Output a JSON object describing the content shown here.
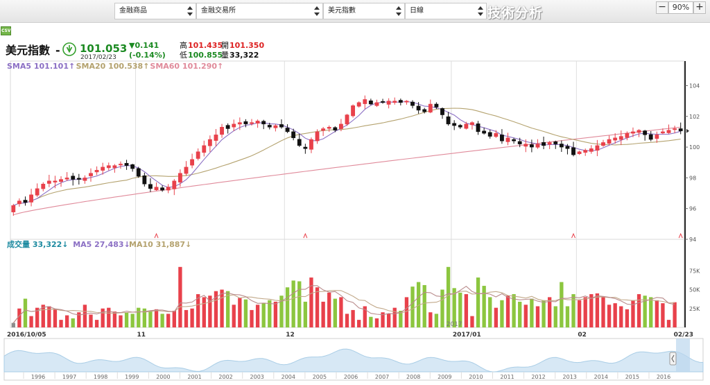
{
  "toolbar": {
    "selects": [
      {
        "value": "金融商品"
      },
      {
        "value": "金融交易所"
      },
      {
        "value": "美元指數"
      },
      {
        "value": "日線"
      }
    ],
    "title": "技術分析",
    "zoom": {
      "minus": "−",
      "level": "90%",
      "plus": "+"
    },
    "csv_label": "CSV"
  },
  "colors": {
    "up": "#e8414b",
    "down": "#111111",
    "vol_up": "#e8414b",
    "vol_down": "#8cc63f",
    "vol_neutral": "#8c8c8c",
    "sma5": "#8b6fc4",
    "sma20": "#b4a26e",
    "sma60": "#e08a9a",
    "ma5_vol": "#b88a8a",
    "ma10_vol": "#c2a98a",
    "navigator": "#a9cde6"
  },
  "chart_data": {
    "type": "candlestick",
    "symbol": "美元指數",
    "quote": {
      "last": "101.053",
      "date": "2017/02/23",
      "change": "▼0.141",
      "change_pct": "(-0.14%)",
      "high_label": "高",
      "high": "101.435",
      "open_label": "開",
      "open": "101.350",
      "low_label": "低",
      "low": "100.855",
      "volume_label": "量",
      "volume": "33,322"
    },
    "sma_legend": [
      {
        "label": "SMA5",
        "value": "101.101",
        "arrow": "↑"
      },
      {
        "label": "SMA20",
        "value": "100.538",
        "arrow": "↑"
      },
      {
        "label": "SMA60",
        "value": "101.290",
        "arrow": "↑"
      }
    ],
    "volume_legend": [
      {
        "label": "成交量",
        "value": "33,322",
        "arrow": "↓"
      },
      {
        "label": "MA5",
        "value": "27,483",
        "arrow": "↓"
      },
      {
        "label": "MA10",
        "value": "31,887",
        "arrow": "↓"
      }
    ],
    "price_axis": {
      "ylim": [
        94,
        105.6
      ],
      "ticks": [
        "104",
        "102",
        "100",
        "98",
        "96",
        "94"
      ]
    },
    "volume_axis": {
      "ylim": [
        0,
        100000
      ],
      "ticks": [
        "75K",
        "50K",
        "25K"
      ]
    },
    "x_labels": [
      "2016/10/05",
      "11",
      "12",
      "2017/01",
      "02",
      "02/23"
    ],
    "x_label_index": [
      0,
      21,
      46,
      74,
      95,
      112
    ],
    "year_watermark": "2017",
    "navigator_years": [
      "1996",
      "1997",
      "1998",
      "1999",
      "2000",
      "2001",
      "2002",
      "2003",
      "2004",
      "2005",
      "2006",
      "2007",
      "2008",
      "2009",
      "2010",
      "2011",
      "2012",
      "2013",
      "2014",
      "2015",
      "2016"
    ],
    "close": [
      96.2,
      96.5,
      96.4,
      96.9,
      97.3,
      97.6,
      97.8,
      97.8,
      97.9,
      98.0,
      97.9,
      97.9,
      98.0,
      98.3,
      98.5,
      98.7,
      98.8,
      98.8,
      98.9,
      98.8,
      98.6,
      98.1,
      97.6,
      97.3,
      97.4,
      97.2,
      97.4,
      97.8,
      98.3,
      98.7,
      99.2,
      99.7,
      100.1,
      100.5,
      100.8,
      101.3,
      101.2,
      101.5,
      101.6,
      101.5,
      101.6,
      101.7,
      101.5,
      101.3,
      101.4,
      101.3,
      101.0,
      100.6,
      100.1,
      99.9,
      100.5,
      101.0,
      101.2,
      101.3,
      101.1,
      101.5,
      102.1,
      102.7,
      102.9,
      103.1,
      102.8,
      102.9,
      102.9,
      103.0,
      103.0,
      102.9,
      103.0,
      102.7,
      102.4,
      102.3,
      102.8,
      102.6,
      102.1,
      101.5,
      101.4,
      101.3,
      101.5,
      101.6,
      101.0,
      100.9,
      100.7,
      100.9,
      100.4,
      100.6,
      100.4,
      100.2,
      100.2,
      100.0,
      100.2,
      100.1,
      100.3,
      100.2,
      100.0,
      99.9,
      99.5,
      99.7,
      99.8,
      99.9,
      100.1,
      100.3,
      100.5,
      100.6,
      100.7,
      100.9,
      101.0,
      101.1,
      100.8,
      100.5,
      100.8,
      101.0,
      101.1,
      101.2,
      101.05
    ],
    "ohlc_note": "close series; open/high/low derived by script for rendering only",
    "volume": [
      6000,
      25000,
      38000,
      15000,
      26000,
      30000,
      28000,
      24000,
      10000,
      16000,
      12000,
      20000,
      30000,
      17000,
      10000,
      25000,
      26000,
      21000,
      16000,
      20000,
      18000,
      26000,
      25000,
      22000,
      24000,
      18000,
      18000,
      22000,
      80000,
      23000,
      25000,
      44000,
      40000,
      42000,
      48000,
      50000,
      48000,
      30000,
      39000,
      37000,
      23000,
      30000,
      32000,
      36000,
      34000,
      42000,
      53000,
      62000,
      61000,
      34000,
      66000,
      53000,
      34000,
      46000,
      38000,
      40000,
      18000,
      23000,
      10000,
      28000,
      14000,
      12000,
      20000,
      18000,
      26000,
      22000,
      40000,
      54000,
      60000,
      56000,
      20000,
      18000,
      50000,
      80000,
      52000,
      46000,
      44000,
      15000,
      66000,
      55000,
      40000,
      26000,
      36000,
      42000,
      44000,
      34000,
      30000,
      38000,
      28000,
      36000,
      40000,
      28000,
      60000,
      28000,
      44000,
      36000,
      40000,
      44000,
      45000,
      40000,
      30000,
      32000,
      28000,
      24000,
      36000,
      44000,
      42000,
      40000,
      36000,
      32000,
      10000,
      33322
    ]
  }
}
